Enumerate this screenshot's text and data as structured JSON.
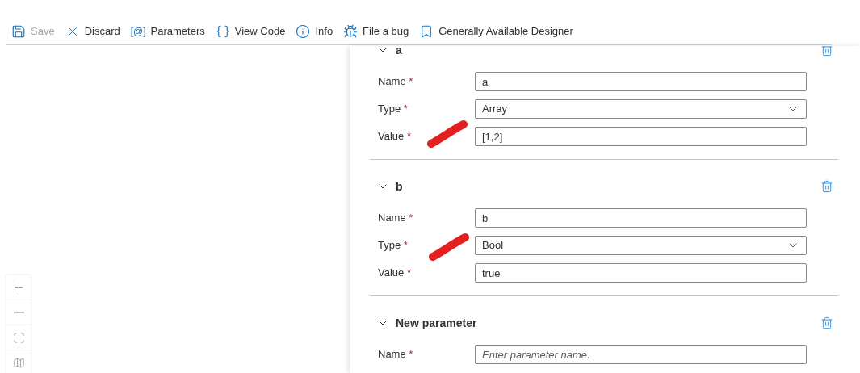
{
  "toolbar": [
    {
      "kind": "save",
      "label": "Save",
      "disabled": true
    },
    {
      "kind": "discard",
      "label": "Discard",
      "disabled": false
    },
    {
      "kind": "parameters",
      "glyph": "[@]",
      "label": "Parameters",
      "disabled": false
    },
    {
      "kind": "code",
      "label": "View Code",
      "disabled": false
    },
    {
      "kind": "info",
      "label": "Info",
      "disabled": false
    },
    {
      "kind": "bug",
      "label": "File a bug",
      "disabled": false
    },
    {
      "kind": "bookmark",
      "label": "Generally Available Designer",
      "disabled": false
    }
  ],
  "parameters": [
    {
      "title": "a",
      "expanded": true,
      "fields": [
        {
          "kind": "text",
          "label": "Name",
          "required_mark": "*",
          "value": "a"
        },
        {
          "kind": "select",
          "label": "Type",
          "required_mark": "*",
          "value": "Array"
        },
        {
          "kind": "text",
          "label": "Value",
          "required_mark": "*",
          "value": "[1,2]"
        }
      ]
    },
    {
      "title": "b",
      "expanded": true,
      "fields": [
        {
          "kind": "text",
          "label": "Name",
          "required_mark": "*",
          "value": "b"
        },
        {
          "kind": "select",
          "label": "Type",
          "required_mark": "*",
          "value": "Bool"
        },
        {
          "kind": "text",
          "label": "Value",
          "required_mark": "*",
          "value": "true"
        }
      ]
    },
    {
      "title": "New parameter",
      "expanded": true,
      "fields": [
        {
          "kind": "text",
          "label": "Name",
          "required_mark": "*",
          "placeholder": "Enter parameter name."
        }
      ]
    }
  ]
}
